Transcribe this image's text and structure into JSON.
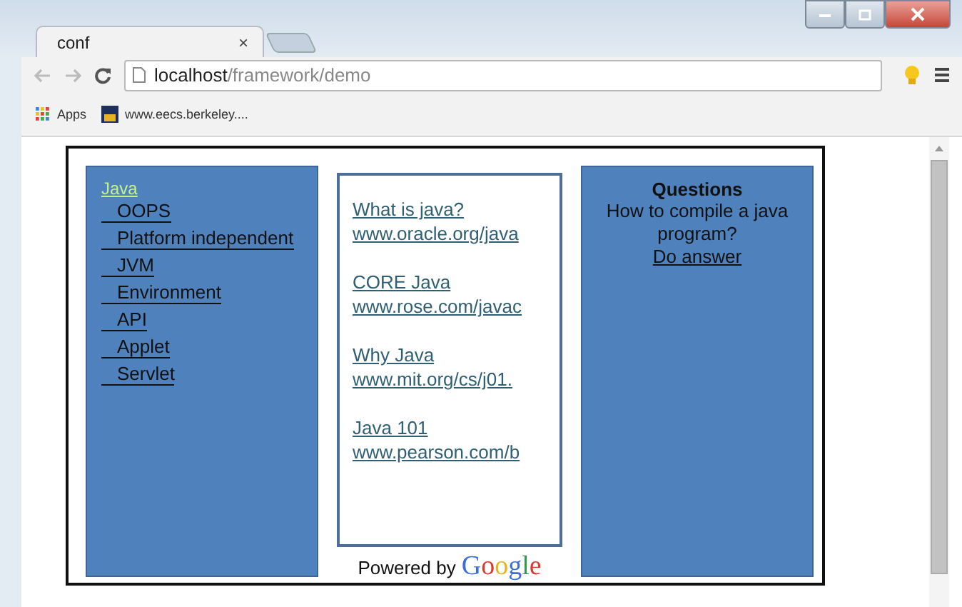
{
  "window": {
    "tab_title": "conf",
    "tab_close": "×",
    "url_host": "localhost",
    "url_path": "/framework/demo"
  },
  "bookmarks": [
    {
      "label": "Apps",
      "kind": "apps"
    },
    {
      "label": "www.eecs.berkeley....",
      "kind": "site"
    }
  ],
  "left_panel": {
    "title": "Java",
    "items": [
      "OOPS",
      "Platform independent",
      "JVM",
      "Environment",
      "API",
      "Applet",
      "Servlet"
    ]
  },
  "middle_panel": {
    "links": [
      {
        "title": "What is java?",
        "url": "www.oracle.org/java"
      },
      {
        "title": "CORE Java",
        "url": "www.rose.com/javac"
      },
      {
        "title": "Why Java",
        "url": "www.mit.org/cs/j01."
      },
      {
        "title": "Java 101",
        "url": "www.pearson.com/b"
      }
    ],
    "powered_by": "Powered by",
    "logo": "Google"
  },
  "right_panel": {
    "title": "Questions",
    "question": "How to compile a java program?",
    "answer_link": "Do answer"
  }
}
